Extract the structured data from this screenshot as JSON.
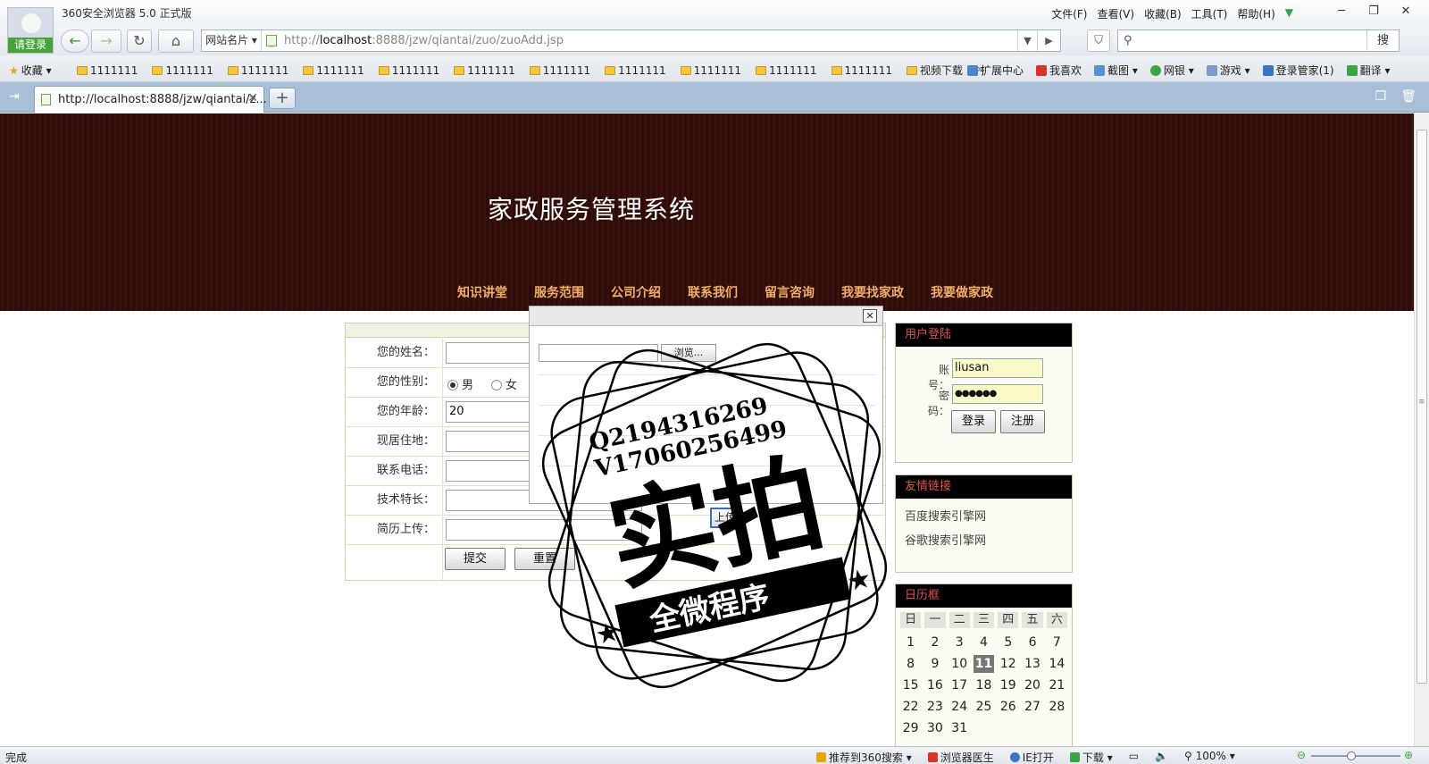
{
  "browser": {
    "app_title": "360安全浏览器 5.0 正式版",
    "login_label": "请登录",
    "menu": [
      "文件(F)",
      "查看(V)",
      "收藏(B)",
      "工具(T)",
      "帮助(H)"
    ],
    "sites_label": "网站名片",
    "url_prefix": "http://",
    "url_host": "localhost",
    "url_rest": ":8888/jzw/qiantai/zuo/zuoAdd.jsp",
    "search_button": "搜",
    "favorites_label": "收藏",
    "bookmark_folders": [
      "1111111",
      "1111111",
      "1111111",
      "1111111",
      "1111111",
      "1111111",
      "1111111",
      "1111111",
      "1111111",
      "1111111",
      "1111111",
      "视频下载"
    ],
    "toolbar_items": [
      "扩展中心",
      "我喜欢",
      "截图",
      "网银",
      "游戏",
      "登录管家(1)",
      "翻译"
    ],
    "tab_title": "http://localhost:8888/jzw/qiantai/z...",
    "status_text": "完成",
    "status_tools": [
      "推荐到360搜索",
      "浏览器医生",
      "IE打开",
      "下载"
    ],
    "zoom": "100%"
  },
  "site": {
    "title": "家政服务管理系统",
    "nav": [
      "知识讲堂",
      "服务范围",
      "公司介绍",
      "联系我们",
      "留言咨询",
      "我要找家政",
      "我要做家政"
    ]
  },
  "form": {
    "name_label": "您的姓名：",
    "gender_label": "您的性别：",
    "gender_male": "男",
    "gender_female": "女",
    "age_label": "您的年龄：",
    "age_value": "20",
    "address_label": "现居住地：",
    "phone_label": "联系电话：",
    "skill_label": "技术特长：",
    "resume_label": "简历上传：",
    "submit": "提交",
    "reset": "重置"
  },
  "upload_popup": {
    "browse": "浏览...",
    "upload": "上传"
  },
  "sidebar": {
    "login_title": "用户登陆",
    "account_label": "账号：",
    "account_value": "liusan",
    "password_label": "密码：",
    "password_value": "●●●●●●",
    "login_button": "登录",
    "register_button": "注册",
    "links_title": "友情链接",
    "links": [
      "百度搜索引擎网",
      "谷歌搜索引擎网"
    ],
    "calendar_title": "日历框",
    "weekdays": [
      "日",
      "一",
      "二",
      "三",
      "四",
      "五",
      "六"
    ],
    "days": [
      "1",
      "2",
      "3",
      "4",
      "5",
      "6",
      "7",
      "8",
      "9",
      "10",
      "11",
      "12",
      "13",
      "14",
      "15",
      "16",
      "17",
      "18",
      "19",
      "20",
      "21",
      "22",
      "23",
      "24",
      "25",
      "26",
      "27",
      "28",
      "29",
      "30",
      "31"
    ],
    "today": "11"
  },
  "watermark": {
    "qq": "Q2194316269",
    "vx": "V17060256499",
    "big": "实拍",
    "ribbon": "全微程序"
  }
}
